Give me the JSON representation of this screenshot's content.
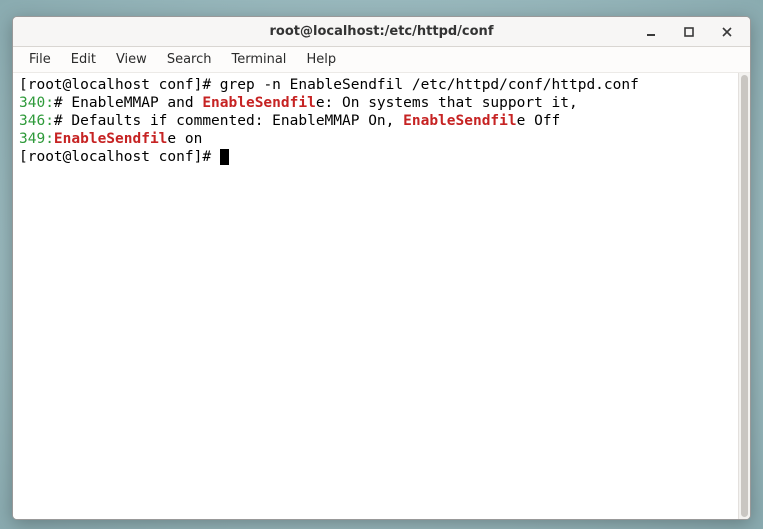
{
  "window": {
    "title": "root@localhost:/etc/httpd/conf"
  },
  "menubar": {
    "items": [
      "File",
      "Edit",
      "View",
      "Search",
      "Terminal",
      "Help"
    ]
  },
  "terminal": {
    "prompt": "[root@localhost conf]# ",
    "command": "grep -n EnableSendfil /etc/httpd/conf/httpd.conf",
    "lines": [
      {
        "lineno": "340:",
        "pre": "# EnableMMAP and ",
        "match": "EnableSendfil",
        "post": "e: On systems that support it,"
      },
      {
        "lineno": "346:",
        "pre": "# Defaults if commented: EnableMMAP On, ",
        "match": "EnableSendfil",
        "post": "e Off"
      },
      {
        "lineno": "349:",
        "pre": "",
        "match": "EnableSendfil",
        "post": "e on"
      }
    ],
    "prompt2": "[root@localhost conf]# "
  }
}
